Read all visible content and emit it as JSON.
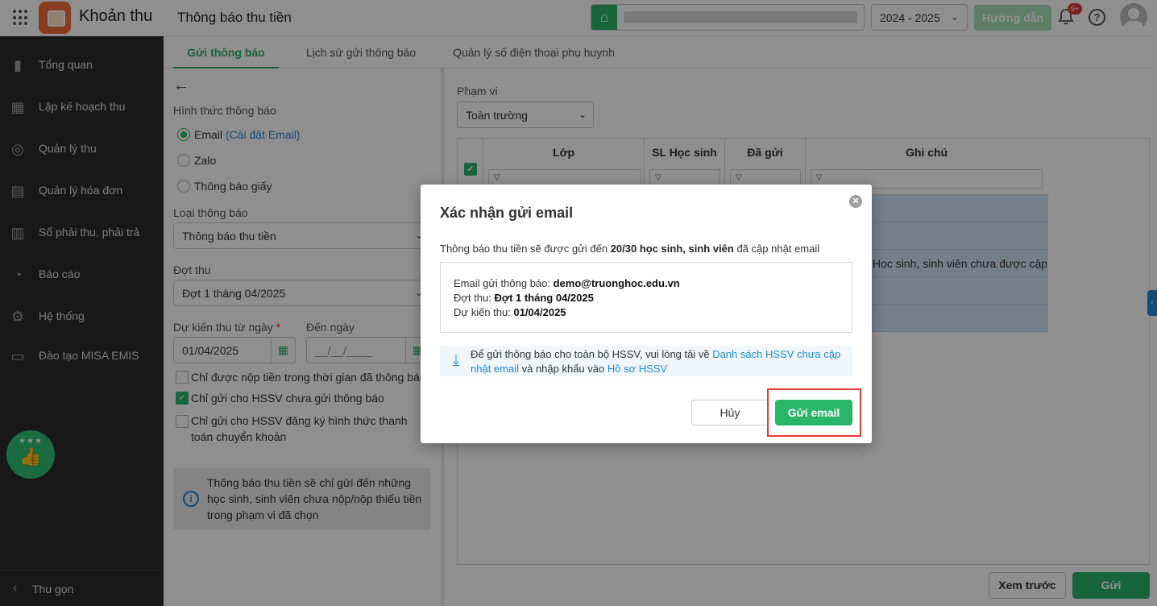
{
  "app": {
    "name": "Khoản thu",
    "page_title": "Thông báo thu tiền"
  },
  "header": {
    "school_year": "2024 - 2025",
    "guide_label": "Hướng dẫn",
    "notification_badge": "9+",
    "help_glyph": "?"
  },
  "sidebar": {
    "items": [
      {
        "label": "Tổng quan",
        "icon": "bar-chart-icon"
      },
      {
        "label": "Lập kế hoạch thu",
        "icon": "calendar-money-icon"
      },
      {
        "label": "Quản lý thu",
        "icon": "money-hand-icon"
      },
      {
        "label": "Quản lý hóa đơn",
        "icon": "invoice-icon"
      },
      {
        "label": "Sổ phải thu, phải trả",
        "icon": "ledger-icon"
      },
      {
        "label": "Báo cáo",
        "icon": "pie-chart-icon"
      },
      {
        "label": "Hệ thống",
        "icon": "gear-icon"
      },
      {
        "label": "Đào tạo MISA EMIS",
        "icon": "book-icon"
      }
    ],
    "collapse_label": "Thu gọn"
  },
  "tabs": [
    {
      "label": "Gửi thông báo",
      "active": true
    },
    {
      "label": "Lịch sử gửi thông báo",
      "active": false
    },
    {
      "label": "Quản lý số điện thoại phụ huynh",
      "active": false
    }
  ],
  "form": {
    "method_label": "Hình thức thông báo",
    "method_email": "Email",
    "method_email_link": "(Cài đặt Email)",
    "method_zalo": "Zalo",
    "method_paper": "Thông báo giấy",
    "type_label": "Loại thông báo",
    "type_value": "Thông báo thu tiền",
    "period_label": "Đợt thu",
    "period_value": "Đợt 1 tháng 04/2025",
    "from_label": "Dự kiến thu từ ngày",
    "required_mark": "*",
    "to_label": "Đến ngày",
    "from_value": "01/04/2025",
    "to_placeholder": "__/__/____",
    "check_paid_in_period": "Chỉ được nộp tiền trong thời gian đã thông báo",
    "check_not_sent": "Chỉ gửi cho HSSV chưa gửi thông báo",
    "check_transfer": "Chỉ gửi cho HSSV đăng ký hình thức thanh toán chuyển khoản",
    "info_text": "Thông báo thu tiền sẽ chỉ gửi đến những học sinh, sinh viên chưa nộp/nộp thiếu tiền trong phạm vi đã chọn"
  },
  "right": {
    "scope_label": "Phạm vi",
    "scope_value": "Toàn trường",
    "columns": [
      "Lớp",
      "SL Học sinh",
      "Đã gửi",
      "Ghi chú"
    ],
    "row_note": "Học sinh, sinh viên chưa được cập nhật email",
    "preview_label": "Xem trước",
    "send_label": "Gửi"
  },
  "dialog": {
    "title": "Xác nhận gửi email",
    "msg_prefix": "Thông báo thu tiền sẽ được gửi đến ",
    "msg_count": "20/30 học sinh, sinh viên",
    "msg_suffix": " đã cập nhật email",
    "email_label": "Email gửi thông báo: ",
    "email_value": "demo@truonghoc.edu.vn",
    "period_label": "Đợt thu: ",
    "period_value": "Đợt 1 tháng 04/2025",
    "date_label": "Dự kiến thu: ",
    "date_value": "01/04/2025",
    "download_prefix": "Để gửi thông báo cho toàn bộ HSSV, vui lòng tải về ",
    "download_link": "Danh sách HSSV chưa cập nhật email",
    "download_middle": " và nhập khẩu vào ",
    "profile_link": "Hồ sơ HSSV",
    "cancel_label": "Hủy",
    "confirm_label": "Gửi email"
  },
  "colors": {
    "accent": "#2bb56a",
    "link": "#1f8ad6",
    "sidebar_bg": "#2b2b2b",
    "highlight": "#e53935"
  }
}
